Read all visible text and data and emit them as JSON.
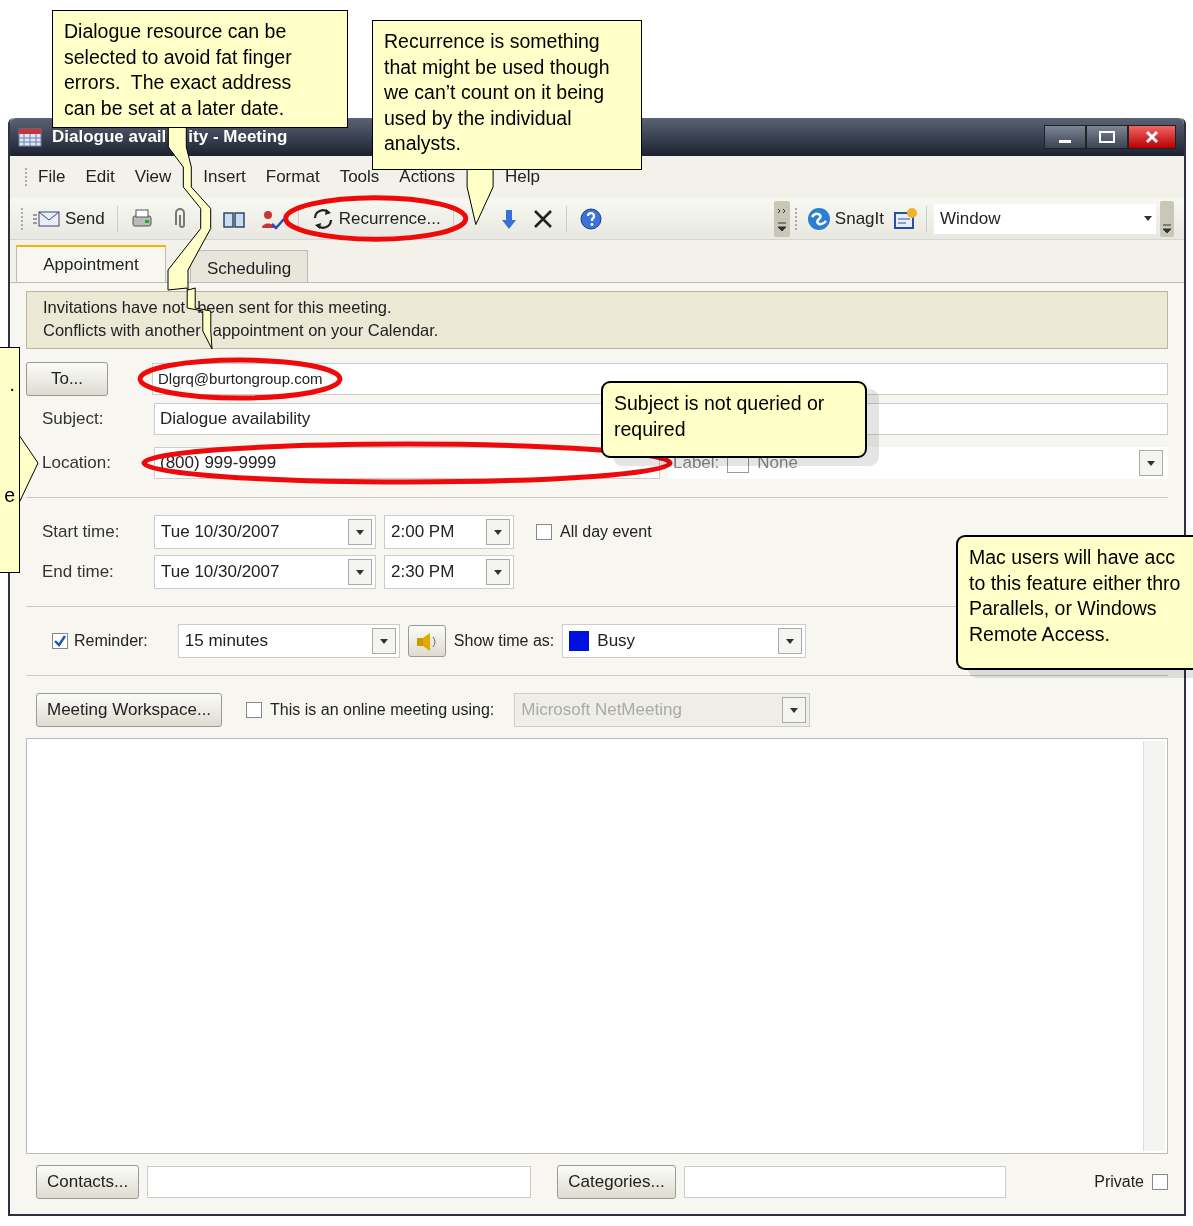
{
  "window": {
    "title": [
      "Dialogue avail",
      "ity - Meeting"
    ]
  },
  "menu": [
    "File",
    "Edit",
    "View",
    "Insert",
    "Format",
    "Tools",
    "Actions",
    "Help"
  ],
  "toolbar": [
    {
      "kind": "send",
      "label": "Send"
    },
    {
      "kind": "print"
    },
    {
      "kind": "attach"
    },
    {
      "kind": "book"
    },
    {
      "kind": "check"
    },
    {
      "kind": "recurrence",
      "label": "Recurrence..."
    },
    {
      "kind": "down"
    },
    {
      "kind": "delete"
    },
    {
      "kind": "help"
    }
  ],
  "toolbar2": {
    "label": "SnagIt",
    "window_value": "Window"
  },
  "tabs": [
    {
      "label": "Appointment",
      "selected": true
    },
    {
      "label": "Scheduling",
      "selected": false
    }
  ],
  "info": [
    [
      "Invitations have not",
      "been sent for this meeting."
    ],
    [
      "Conflicts with another",
      "appointment on your Calendar."
    ]
  ],
  "to": {
    "button": "To...",
    "value": "Dlgrq@burtongroup.com"
  },
  "subject": {
    "label": "Subject:",
    "value": "Dialogue availability"
  },
  "location": {
    "label": "Location:",
    "value": "(800) 999-9999",
    "picker_label": "Label:",
    "picker_value": "None"
  },
  "times": [
    {
      "label": "Start time:",
      "date": "Tue 10/30/2007",
      "time": "2:00 PM"
    },
    {
      "label": "End time:",
      "date": "Tue 10/30/2007",
      "time": "2:30 PM"
    }
  ],
  "all_day": {
    "label": "All day event",
    "checked": false
  },
  "reminder": {
    "label": "Reminder:",
    "checked": true,
    "value": "15 minutes"
  },
  "show_time_as": {
    "label": "Show time as:",
    "value": "Busy",
    "color": "#0010e0"
  },
  "workspace": {
    "button": "Meeting Workspace..."
  },
  "online": {
    "label": "This is an online meeting using:",
    "checked": false,
    "value": "Microsoft NetMeeting",
    "disabled": true
  },
  "footer": {
    "contacts": "Contacts...",
    "categories": "Categories...",
    "private": {
      "label": "Private",
      "checked": false
    }
  },
  "callouts": [
    {
      "kind": "pointer",
      "lines": [
        "Dialogue resource can be",
        "selected to avoid fat finger",
        "errors.  The exact address",
        "can be set at a later date."
      ]
    },
    {
      "kind": "pointer",
      "lines": [
        "Recurrence is something",
        "that might be used though",
        "we can’t count on it being",
        "used by the individual",
        "analysts."
      ]
    },
    {
      "kind": "cut",
      "fragments": [
        ".",
        "e"
      ]
    },
    {
      "kind": "rounded",
      "lines": [
        "Subject is not queried or",
        "required"
      ]
    },
    {
      "kind": "rounded",
      "lines": [
        "Mac users will have acc",
        "to this feature either thro",
        "Parallels, or Windows",
        "Remote Access."
      ]
    }
  ]
}
